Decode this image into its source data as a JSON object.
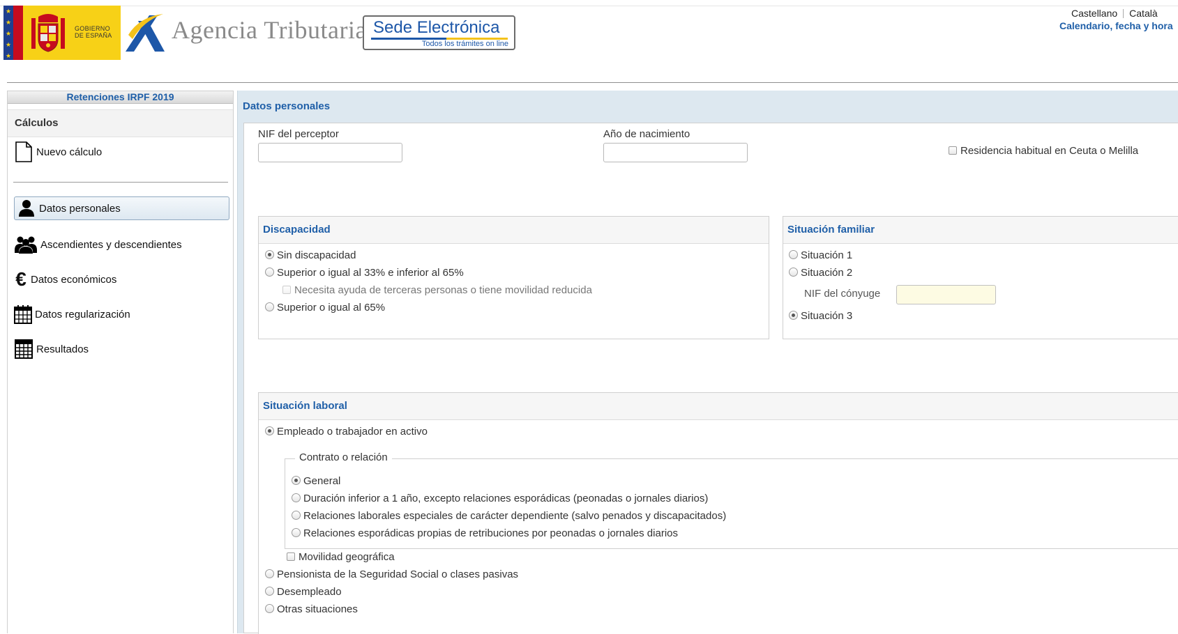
{
  "header": {
    "gobierno_text": "GOBIERNO\nDE ESPAÑA",
    "agency_name": "Agencia Tributaria",
    "sede_title": "Sede Electrónica",
    "sede_subtitle": "Todos los trámites on line",
    "lang_castellano": "Castellano",
    "lang_catala": "Català",
    "calendar_link": "Calendario, fecha y hora",
    "colors": {
      "brand_blue": "#1f5fa8",
      "spain_yellow": "#f7d117",
      "spain_red": "#c60b1e"
    }
  },
  "sidebar": {
    "app_title": "Retenciones IRPF 2019",
    "section_title": "Cálculos",
    "new_calc": "Nuevo cálculo",
    "items": [
      {
        "label": "Datos personales",
        "icon": "person-icon",
        "active": true
      },
      {
        "label": "Ascendientes y descendientes",
        "icon": "group-icon",
        "active": false
      },
      {
        "label": "Datos económicos",
        "icon": "euro-icon",
        "active": false
      },
      {
        "label": "Datos regularización",
        "icon": "calendar-icon",
        "active": false
      },
      {
        "label": "Resultados",
        "icon": "calculator-icon",
        "active": false
      }
    ]
  },
  "main": {
    "title": "Datos personales",
    "nif_perceptor_label": "NIF del perceptor",
    "nif_perceptor_value": "",
    "anio_nacimiento_label": "Año de nacimiento",
    "anio_nacimiento_value": "",
    "residencia_label": "Residencia habitual en Ceuta o Melilla",
    "discapacidad": {
      "title": "Discapacidad",
      "options": [
        "Sin discapacidad",
        "Superior o igual al 33% e inferior al 65%",
        "Superior o igual al 65%"
      ],
      "selected": "Sin discapacidad",
      "ayuda_label": "Necesita ayuda de terceras personas o tiene movilidad reducida"
    },
    "situacion_familiar": {
      "title": "Situación familiar",
      "options": [
        "Situación 1",
        "Situación 2",
        "Situación 3"
      ],
      "selected": "Situación 3",
      "nif_conyuge_label": "NIF del cónyuge",
      "nif_conyuge_value": ""
    },
    "situacion_laboral": {
      "title": "Situación laboral",
      "empleado_label": "Empleado o trabajador en activo",
      "contrato_legend": "Contrato o relación",
      "contrato_options": [
        "General",
        "Duración inferior a 1 año, excepto relaciones esporádicas (peonadas o jornales diarios)",
        "Relaciones laborales especiales de carácter dependiente (salvo penados y discapacitados)",
        "Relaciones esporádicas propias de retribuciones por peonadas o jornales diarios"
      ],
      "contrato_selected": "General",
      "movilidad_label": "Movilidad geográfica",
      "other_options": [
        "Pensionista de la Seguridad Social o clases pasivas",
        "Desempleado",
        "Otras situaciones"
      ],
      "selected": "Empleado o trabajador en activo"
    }
  }
}
